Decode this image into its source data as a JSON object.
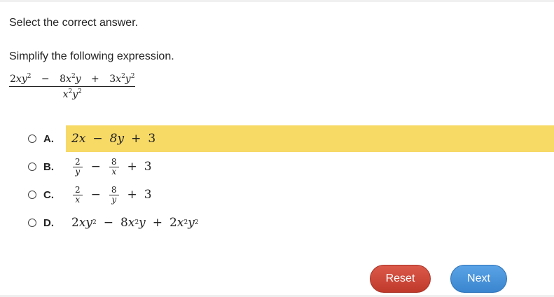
{
  "instruction": "Select the correct answer.",
  "prompt": "Simplify the following expression.",
  "expression": {
    "numerator": {
      "t1_coef": "2",
      "t1_var": "xy",
      "t1_exp": "2",
      "op1": "−",
      "t2_coef": "8",
      "t2_var_a": "x",
      "t2_exp": "2",
      "t2_var_b": "y",
      "op2": "+",
      "t3_coef": "3",
      "t3_var_a": "x",
      "t3_exp_a": "2",
      "t3_var_b": "y",
      "t3_exp_b": "2"
    },
    "denominator": {
      "var_a": "x",
      "exp_a": "2",
      "var_b": "y",
      "exp_b": "2"
    }
  },
  "options": [
    {
      "letter": "A.",
      "selected_highlight": true,
      "t1": "2x",
      "op1": "−",
      "t2": "8y",
      "op2": "+",
      "t3": "3"
    },
    {
      "letter": "B.",
      "f1_num": "2",
      "f1_den": "y",
      "op1": "−",
      "f2_num": "8",
      "f2_den": "x",
      "op2": "+",
      "t3": "3"
    },
    {
      "letter": "C.",
      "f1_num": "2",
      "f1_den": "x",
      "op1": "−",
      "f2_num": "8",
      "f2_den": "y",
      "op2": "+",
      "t3": "3"
    },
    {
      "letter": "D.",
      "t1_coef": "2",
      "t1_var": "xy",
      "t1_exp": "2",
      "op1": "−",
      "t2_coef": "8",
      "t2_var_a": "x",
      "t2_exp": "2",
      "t2_var_b": "y",
      "op2": "+",
      "t3_coef": "2",
      "t3_var_a": "x",
      "t3_exp_a": "2",
      "t3_var_b": "y",
      "t3_exp_b": "2"
    }
  ],
  "buttons": {
    "reset": "Reset",
    "next": "Next"
  },
  "colors": {
    "highlight": "#f7d966",
    "reset": "#c94a3b",
    "next": "#4a95dc"
  }
}
